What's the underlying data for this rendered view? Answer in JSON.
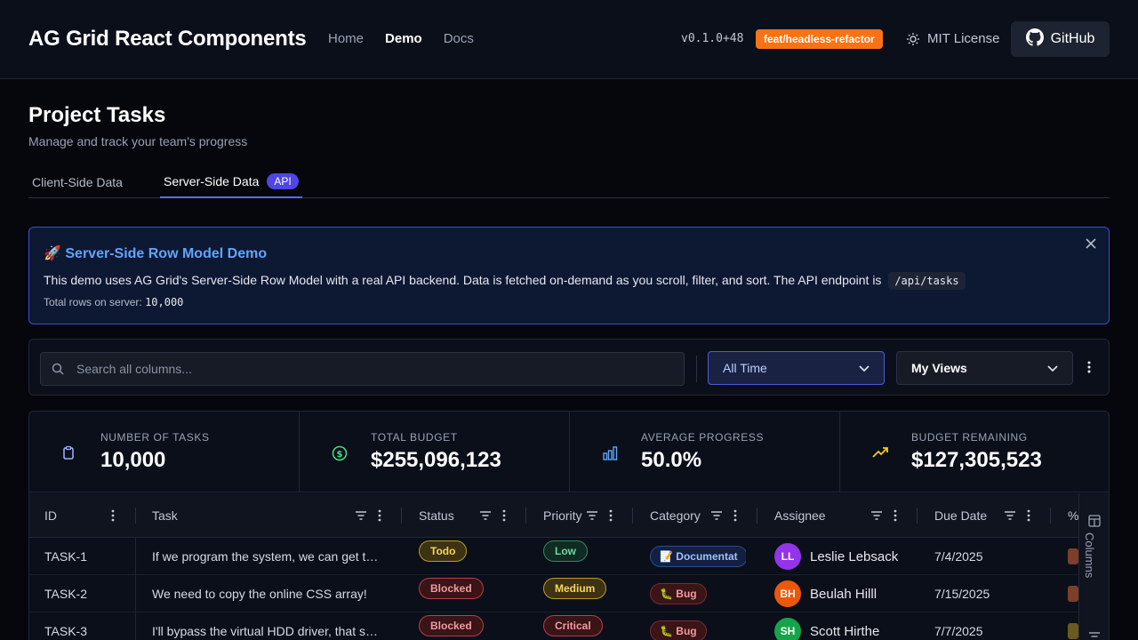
{
  "header": {
    "brand": "AG Grid React Components",
    "nav": [
      "Home",
      "Demo",
      "Docs"
    ],
    "version": "v0.1.0+48",
    "branch": "feat/headless-refactor",
    "license": "MIT License",
    "github": "GitHub"
  },
  "page": {
    "title": "Project Tasks",
    "subtitle": "Manage and track your team's progress"
  },
  "tabs": {
    "client": "Client-Side Data",
    "server": "Server-Side Data",
    "server_badge": "API"
  },
  "banner": {
    "title": "🚀 Server-Side Row Model Demo",
    "text": "This demo uses AG Grid's Server-Side Row Model with a real API backend. Data is fetched on-demand as you scroll, filter, and sort. The API endpoint is",
    "endpoint": "/api/tasks",
    "total_label": "Total rows on server:",
    "total_value": "10,000"
  },
  "toolbar": {
    "search_placeholder": "Search all columns...",
    "date_filter": "All Time",
    "views": "My Views"
  },
  "stats": [
    {
      "label": "NUMBER OF TASKS",
      "value": "10,000",
      "icon": "clipboard-icon",
      "color": "#a5b4fc"
    },
    {
      "label": "TOTAL BUDGET",
      "value": "$255,096,123",
      "icon": "dollar-circle-icon",
      "color": "#4ade80"
    },
    {
      "label": "AVERAGE PROGRESS",
      "value": "50.0%",
      "icon": "bar-chart-icon",
      "color": "#60a5fa"
    },
    {
      "label": "BUDGET REMAINING",
      "value": "$127,305,523",
      "icon": "trending-up-icon",
      "color": "#facc15"
    }
  ],
  "columns": {
    "id": "ID",
    "task": "Task",
    "status": "Status",
    "priority": "Priority",
    "category": "Category",
    "assignee": "Assignee",
    "due": "Due Date",
    "progress": "%"
  },
  "rows": [
    {
      "id": "TASK-1",
      "task": "If we program the system, we can get t…",
      "status": "Todo",
      "priority": "Low",
      "category": "📝 Documentat",
      "initials": "LL",
      "assignee": "Leslie Lebsack",
      "due": "7/4/2025"
    },
    {
      "id": "TASK-2",
      "task": "We need to copy the online CSS array!",
      "status": "Blocked",
      "priority": "Medium",
      "category": "🐛 Bug",
      "initials": "BH",
      "assignee": "Beulah Hilll",
      "due": "7/15/2025"
    },
    {
      "id": "TASK-3",
      "task": "I'll bypass the virtual HDD driver, that s…",
      "status": "Blocked",
      "priority": "Critical",
      "category": "🐛 Bug",
      "initials": "SH",
      "assignee": "Scott Hirthe",
      "due": "7/7/2025"
    }
  ],
  "side_panel": {
    "columns": "Columns"
  },
  "colors": {
    "accent": "#6366f1",
    "branch": "#f97316",
    "avatar_ll": "#9333ea",
    "avatar_bh": "#ea580c",
    "avatar_sh": "#16a34a"
  }
}
